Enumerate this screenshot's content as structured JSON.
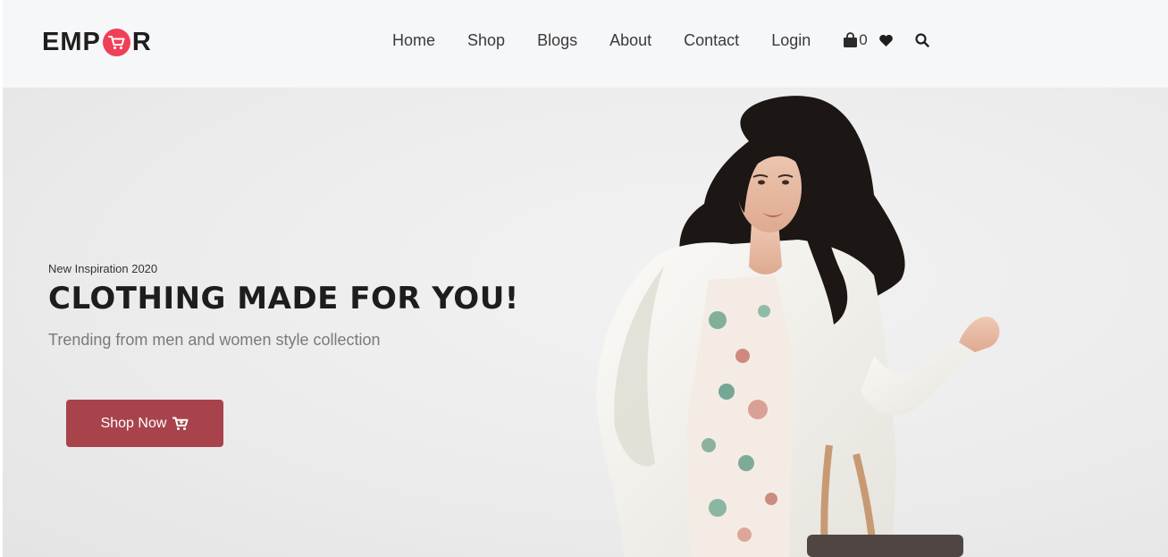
{
  "brand": {
    "logo_left": "EMP",
    "logo_right": "R",
    "accent_color": "#ef4058"
  },
  "nav": {
    "items": [
      "Home",
      "Shop",
      "Blogs",
      "About",
      "Contact",
      "Login"
    ],
    "cart_count": "0",
    "icons": [
      "shopping-bag-icon",
      "heart-icon",
      "search-icon"
    ]
  },
  "hero": {
    "eyebrow": "New Inspiration 2020",
    "headline": "CLOTHING MADE FOR YOU!",
    "subline": "Trending from men and women style collection",
    "button_label": "Shop Now",
    "button_icon": "cart-icon",
    "button_color": "#a8434c"
  }
}
